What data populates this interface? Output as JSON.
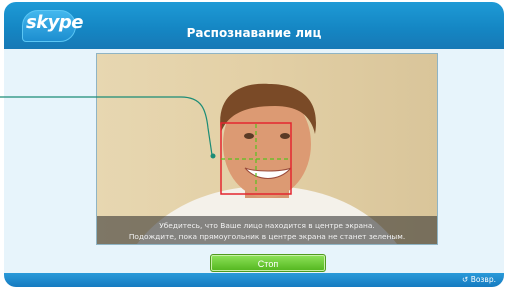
{
  "app": {
    "logo": "skype",
    "title": "Распознавание лиц"
  },
  "camera": {
    "instructions_line1": "Убедитесь, что Ваше лицо находится в центре экрана.",
    "instructions_line2": "Подождите, пока прямоугольник в центре экрана не станет зеленым."
  },
  "actions": {
    "stop_label": "Стоп",
    "back_label": "Возвр.",
    "back_icon": "back-arrow-icon"
  },
  "colors": {
    "header": "#1e9ad6",
    "detection_box": "#e3262f",
    "crosshair": "#58c21f",
    "stop_button": "#52b51e",
    "callout_line": "#1b8c76"
  }
}
